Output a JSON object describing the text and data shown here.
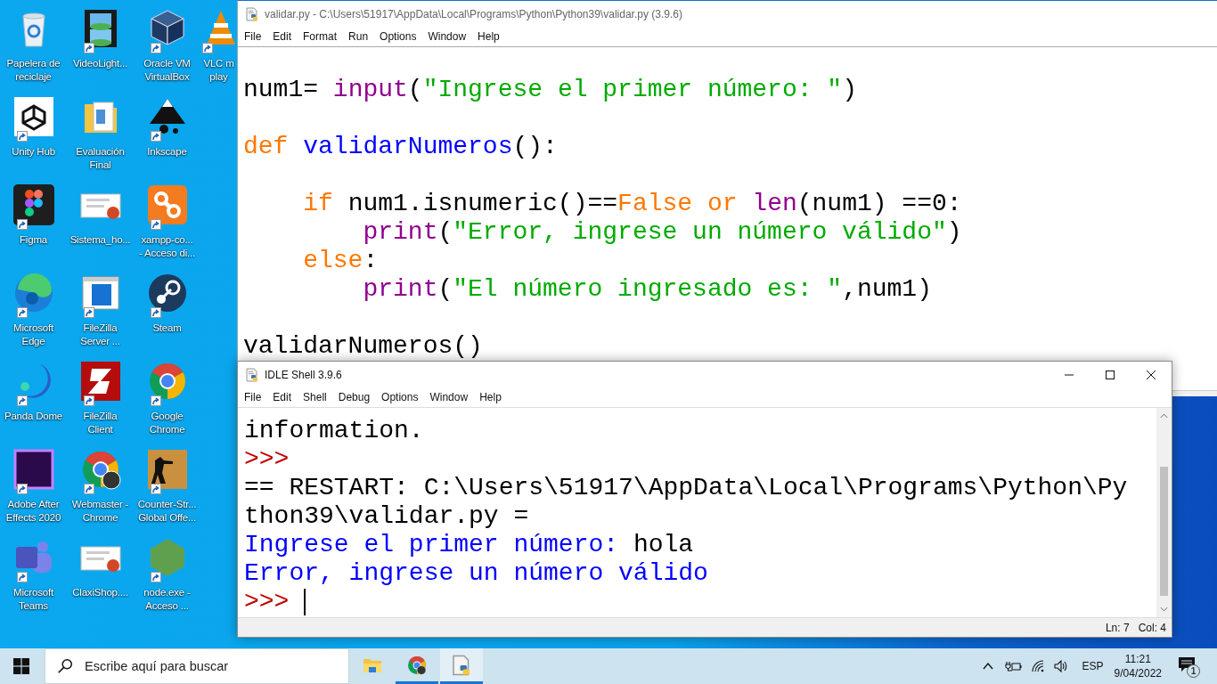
{
  "desktop": {
    "rows": [
      [
        {
          "kind": "bin",
          "label": [
            "Papelera de",
            "reciclaje"
          ],
          "shortcut": false
        },
        {
          "kind": "film",
          "label": [
            "VideoLight..."
          ],
          "shortcut": true
        },
        {
          "kind": "cube",
          "label": [
            "Oracle VM",
            "VirtualBox"
          ],
          "shortcut": true
        },
        {
          "kind": "cone",
          "label": [
            "VLC m",
            "play"
          ],
          "shortcut": true
        }
      ],
      [
        {
          "kind": "unity",
          "label": [
            "Unity Hub"
          ],
          "shortcut": true
        },
        {
          "kind": "folder",
          "label": [
            "Evaluación",
            "Final"
          ],
          "shortcut": false
        },
        {
          "kind": "pen",
          "label": [
            "Inkscape"
          ],
          "shortcut": true
        }
      ],
      [
        {
          "kind": "figma",
          "label": [
            "Figma"
          ],
          "shortcut": true
        },
        {
          "kind": "slides",
          "label": [
            "Sistema_ho..."
          ],
          "shortcut": false
        },
        {
          "kind": "xampp",
          "label": [
            "xampp-co...",
            "- Acceso di..."
          ],
          "shortcut": true
        }
      ],
      [
        {
          "kind": "edge",
          "label": [
            "Microsoft",
            "Edge"
          ],
          "shortcut": true
        },
        {
          "kind": "window",
          "label": [
            "FileZilla",
            "Server ..."
          ],
          "shortcut": true
        },
        {
          "kind": "steam",
          "label": [
            "Steam"
          ],
          "shortcut": true
        }
      ],
      [
        {
          "kind": "panda",
          "label": [
            "Panda Dome"
          ],
          "shortcut": true
        },
        {
          "kind": "filezilla",
          "label": [
            "FileZilla",
            "Client"
          ],
          "shortcut": true
        },
        {
          "kind": "chrome",
          "label": [
            "Google",
            "Chrome"
          ],
          "shortcut": true
        }
      ],
      [
        {
          "kind": "ae",
          "label": [
            "Adobe After",
            "Effects 2020"
          ],
          "shortcut": true
        },
        {
          "kind": "chromeprofile",
          "label": [
            "Webmaster -",
            "Chrome"
          ],
          "shortcut": true
        },
        {
          "kind": "game",
          "label": [
            "Counter-Str...",
            "Global Offe..."
          ],
          "shortcut": true
        }
      ],
      [
        {
          "kind": "teams",
          "label": [
            "Microsoft",
            "Teams"
          ],
          "shortcut": true
        },
        {
          "kind": "slides",
          "label": [
            "ClaxiShop...."
          ],
          "shortcut": false
        },
        {
          "kind": "node",
          "label": [
            "node.exe -",
            "Acceso ..."
          ],
          "shortcut": true
        }
      ]
    ]
  },
  "editor_window": {
    "title": "validar.py - C:\\Users\\51917\\AppData\\Local\\Programs\\Python\\Python39\\validar.py (3.9.6)",
    "menu": [
      "File",
      "Edit",
      "Format",
      "Run",
      "Options",
      "Window",
      "Help"
    ],
    "lines": [
      {
        "kind": "blank"
      },
      {
        "kind": "code",
        "segments": [
          {
            "text": "num1= ",
            "kind": "plain"
          },
          {
            "text": "input",
            "kind": "builtin"
          },
          {
            "text": "(",
            "kind": "plain"
          },
          {
            "text": "\"Ingrese el primer número: \"",
            "kind": "string"
          },
          {
            "text": ")",
            "kind": "plain"
          }
        ]
      },
      {
        "kind": "blank"
      },
      {
        "kind": "code",
        "segments": [
          {
            "text": "def",
            "kind": "keyword"
          },
          {
            "text": " validarNumeros",
            "kind": "definition"
          },
          {
            "text": "():",
            "kind": "plain"
          }
        ]
      },
      {
        "kind": "blank"
      },
      {
        "kind": "code",
        "segments": [
          {
            "text": "    if",
            "kind": "keyword"
          },
          {
            "text": " num1.isnumeric()==",
            "kind": "plain"
          },
          {
            "text": "False",
            "kind": "keyword"
          },
          {
            "text": " or",
            "kind": "keyword"
          },
          {
            "text": " len",
            "kind": "builtin"
          },
          {
            "text": "(num1) ==0:",
            "kind": "plain"
          }
        ]
      },
      {
        "kind": "code",
        "segments": [
          {
            "text": "        print",
            "kind": "builtin"
          },
          {
            "text": "(",
            "kind": "plain"
          },
          {
            "text": "\"Error, ingrese un número válido\"",
            "kind": "string"
          },
          {
            "text": ")",
            "kind": "plain"
          }
        ]
      },
      {
        "kind": "code",
        "segments": [
          {
            "text": "    else",
            "kind": "keyword"
          },
          {
            "text": ":",
            "kind": "plain"
          }
        ]
      },
      {
        "kind": "code",
        "segments": [
          {
            "text": "        print",
            "kind": "builtin"
          },
          {
            "text": "(",
            "kind": "plain"
          },
          {
            "text": "\"El número ingresado es: \"",
            "kind": "string"
          },
          {
            "text": ",num1)",
            "kind": "plain"
          }
        ]
      },
      {
        "kind": "blank"
      },
      {
        "kind": "code",
        "segments": [
          {
            "text": "validarNumeros()",
            "kind": "plain"
          }
        ]
      }
    ]
  },
  "shell_window": {
    "title": "IDLE Shell 3.9.6",
    "menu": [
      "File",
      "Edit",
      "Shell",
      "Debug",
      "Options",
      "Window",
      "Help"
    ],
    "lines": [
      {
        "cursor": false,
        "segments": [
          {
            "text": "information.",
            "kind": "plain"
          }
        ]
      },
      {
        "cursor": false,
        "segments": [
          {
            "text": ">>>",
            "kind": "prompt"
          }
        ]
      },
      {
        "cursor": false,
        "segments": [
          {
            "text": "== RESTART: C:\\Users\\51917\\AppData\\Local\\Programs\\Python\\Py",
            "kind": "plain"
          }
        ]
      },
      {
        "cursor": false,
        "segments": [
          {
            "text": "thon39\\validar.py =",
            "kind": "plain"
          }
        ]
      },
      {
        "cursor": false,
        "segments": [
          {
            "text": "Ingrese el primer número: ",
            "kind": "output"
          },
          {
            "text": "hola",
            "kind": "input"
          }
        ]
      },
      {
        "cursor": false,
        "segments": [
          {
            "text": "Error, ingrese un número válido",
            "kind": "output"
          }
        ]
      },
      {
        "cursor": true,
        "segments": [
          {
            "text": ">>> ",
            "kind": "prompt"
          }
        ]
      }
    ],
    "status": {
      "line": "Ln: 7",
      "column": "Col: 4"
    }
  },
  "taskbar": {
    "search_placeholder": "Escribe aquí para buscar",
    "apps": [
      {
        "kind": "folder",
        "running": false,
        "selected": false
      },
      {
        "kind": "chrome",
        "running": true,
        "selected": false
      },
      {
        "kind": "idle",
        "running": true,
        "selected": true
      }
    ],
    "language": "ESP",
    "time": "11:21",
    "date": "9/04/2022",
    "notifications": "1"
  }
}
